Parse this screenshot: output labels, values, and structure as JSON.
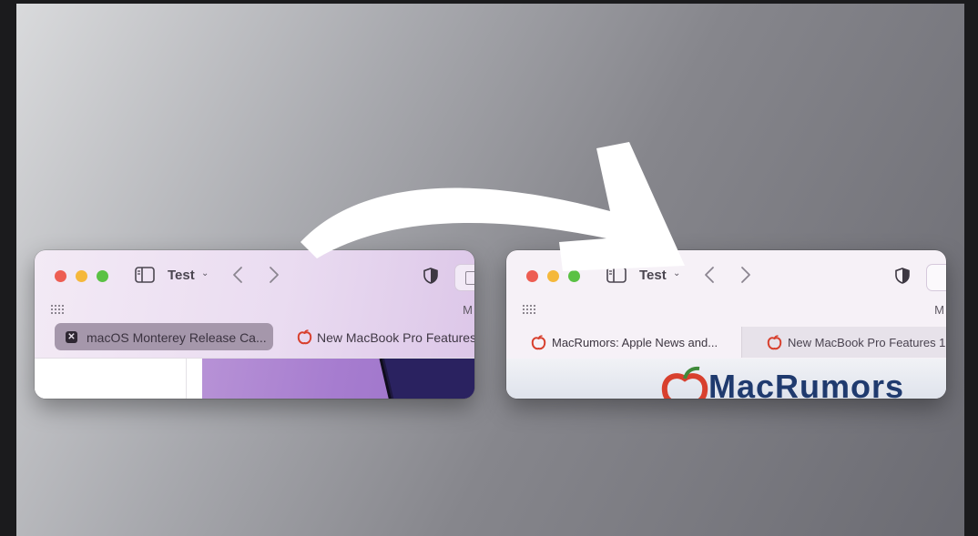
{
  "colors": {
    "close": "#ed5d52",
    "minimize": "#f5b83b",
    "zoom": "#5ac144",
    "brand_red": "#d8402e",
    "brand_blue": "#1f3a6e",
    "arrow": "#ffffff"
  },
  "before_window": {
    "group_name": "Test",
    "favorites_cut": "M",
    "tabs": [
      {
        "label": "macOS Monterey Release Ca...",
        "icon": "close-icon",
        "active": true
      },
      {
        "label": "New MacBook Pro Features",
        "icon": "macrumors-apple-icon",
        "active": false
      }
    ]
  },
  "after_window": {
    "group_name": "Test",
    "favorites_cut": "M",
    "tabs": [
      {
        "label": "MacRumors: Apple News and...",
        "icon": "macrumors-apple-icon",
        "active": true
      },
      {
        "label": "New MacBook Pro Features 1...",
        "icon": "macrumors-apple-icon",
        "active": false
      }
    ],
    "brand_text": "MacRumors"
  }
}
